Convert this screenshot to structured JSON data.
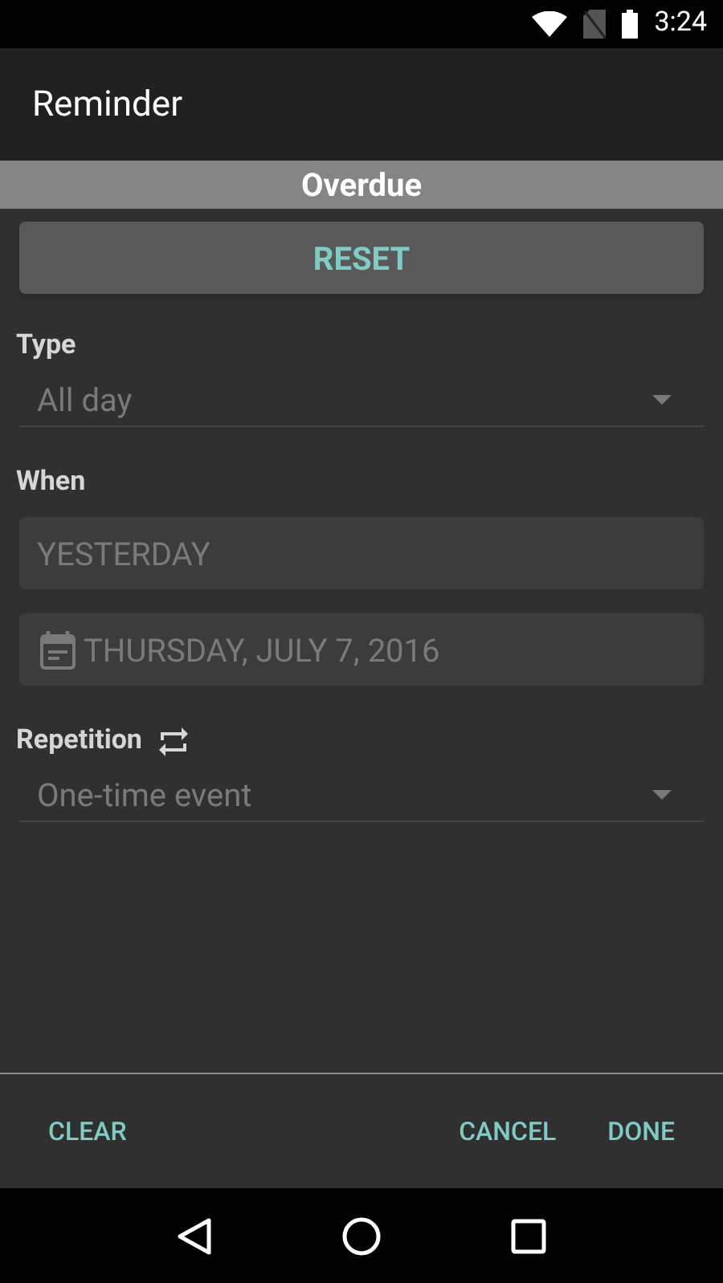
{
  "status_bar": {
    "time": "3:24"
  },
  "toolbar": {
    "title": "Reminder"
  },
  "banner": {
    "text": "Overdue"
  },
  "reset_button": {
    "label": "RESET"
  },
  "type": {
    "label": "Type",
    "value": "All day"
  },
  "when": {
    "label": "When",
    "day": "YESTERDAY",
    "date": "THURSDAY, JULY 7, 2016"
  },
  "repetition": {
    "label": "Repetition",
    "value": "One-time event"
  },
  "actions": [
    {
      "label": "CLEAR",
      "kind": "left"
    },
    {
      "label": "CANCEL",
      "kind": "right"
    },
    {
      "label": "DONE",
      "kind": "right"
    }
  ]
}
